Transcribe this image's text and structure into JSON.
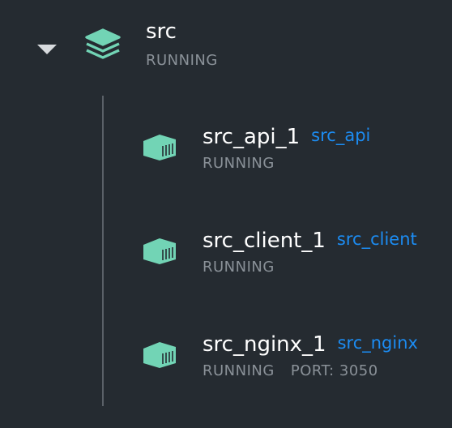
{
  "colors": {
    "background": "#252b31",
    "icon_green": "#72d4b5",
    "link_blue": "#1c8cf2",
    "status_gray": "#8a9198",
    "tree_line": "#5b6168"
  },
  "app": {
    "name": "src",
    "status": "RUNNING",
    "icon": "stack-layers-icon",
    "toggle_icon": "caret-down-icon"
  },
  "containers": [
    {
      "name": "src_api_1",
      "image": "src_api",
      "status": "RUNNING",
      "port": "",
      "icon": "container-icon"
    },
    {
      "name": "src_client_1",
      "image": "src_client",
      "status": "RUNNING",
      "port": "",
      "icon": "container-icon"
    },
    {
      "name": "src_nginx_1",
      "image": "src_nginx",
      "status": "RUNNING",
      "port": "PORT: 3050",
      "icon": "container-icon"
    }
  ]
}
